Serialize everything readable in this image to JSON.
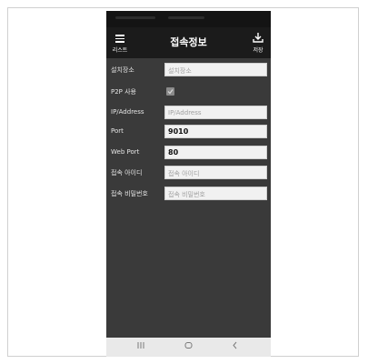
{
  "appbar": {
    "menu_label": "리스트",
    "title": "접속정보",
    "save_label": "저장"
  },
  "form": {
    "location": {
      "label": "설치장소",
      "placeholder": "설치장소"
    },
    "p2p": {
      "label": "P2P 사용",
      "checked": true
    },
    "ip": {
      "label": "IP/Address",
      "placeholder": "IP/Address"
    },
    "port": {
      "label": "Port",
      "value": "9010"
    },
    "web_port": {
      "label": "Web Port",
      "value": "80"
    },
    "user_id": {
      "label": "접속 아이디",
      "placeholder": "접속 아이디"
    },
    "password": {
      "label": "접속 비밀번호",
      "placeholder": "접속 비밀번호"
    }
  },
  "navbar": {
    "recent_icon": "recent-apps-icon",
    "home_icon": "home-icon",
    "back_icon": "back-icon"
  },
  "colors": {
    "screen_bg": "#3a3a3a",
    "appbar_bg": "#1b1b1b",
    "field_bg": "#f1f1f1",
    "navbar_bg": "#e9e9e9"
  }
}
